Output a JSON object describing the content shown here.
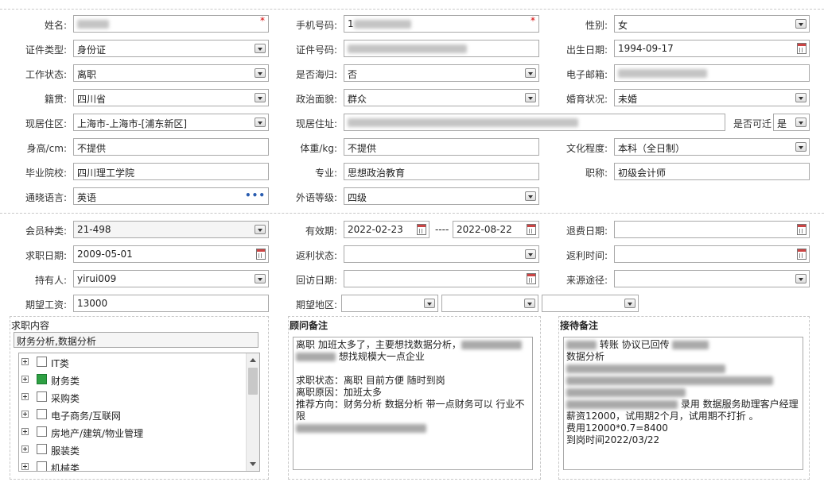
{
  "basic": {
    "name": {
      "label": "姓名:",
      "value": "",
      "required": "*"
    },
    "phone": {
      "label": "手机号码:",
      "value": "1",
      "required": "*"
    },
    "gender": {
      "label": "性别:",
      "value": "女"
    },
    "id_type": {
      "label": "证件类型:",
      "value": "身份证"
    },
    "id_number": {
      "label": "证件号码:",
      "value": ""
    },
    "birth_date": {
      "label": "出生日期:",
      "value": "1994-09-17"
    },
    "work_status": {
      "label": "工作状态:",
      "value": "离职"
    },
    "returnee": {
      "label": "是否海归:",
      "value": "否"
    },
    "email": {
      "label": "电子邮箱:",
      "value": ""
    },
    "native_place": {
      "label": "籍贯:",
      "value": "四川省"
    },
    "political": {
      "label": "政治面貌:",
      "value": "群众"
    },
    "marital": {
      "label": "婚育状况:",
      "value": "未婚"
    },
    "current_area": {
      "label": "现居住区:",
      "value": "上海市-上海市-[浦东新区]"
    },
    "current_address": {
      "label": "现居住址:",
      "value": ""
    },
    "relocate": {
      "label": "是否可迁",
      "value": "是"
    },
    "height": {
      "label": "身高/cm:",
      "value": "不提供"
    },
    "weight": {
      "label": "体重/kg:",
      "value": "不提供"
    },
    "education": {
      "label": "文化程度:",
      "value": "本科（全日制）"
    },
    "school": {
      "label": "毕业院校:",
      "value": "四川理工学院"
    },
    "major": {
      "label": "专业:",
      "value": "思想政治教育"
    },
    "title": {
      "label": "职称:",
      "value": "初级会计师"
    },
    "language": {
      "label": "通晓语言:",
      "value": "英语",
      "more": "•••"
    },
    "foreign_level": {
      "label": "外语等级:",
      "value": "四级"
    }
  },
  "member": {
    "member_type": {
      "label": "会员种类:",
      "value": "21-498"
    },
    "validity": {
      "label": "有效期:",
      "from": "2022-02-23",
      "sep": "----",
      "to": "2022-08-22"
    },
    "refund_date": {
      "label": "退费日期:",
      "value": ""
    },
    "job_date": {
      "label": "求职日期:",
      "value": "2009-05-01"
    },
    "rebate_status": {
      "label": "返利状态:",
      "value": ""
    },
    "rebate_time": {
      "label": "返利时间:",
      "value": ""
    },
    "holder": {
      "label": "持有人:",
      "value": "yirui009"
    },
    "visit_date": {
      "label": "回访日期:",
      "value": ""
    },
    "source": {
      "label": "来源途径:",
      "value": ""
    },
    "salary": {
      "label": "期望工资:",
      "value": "13000"
    },
    "expected_area": {
      "label": "期望地区:",
      "values": [
        "",
        "",
        ""
      ]
    }
  },
  "job_content": {
    "title": "求职内容",
    "selected": "财务分析,数据分析",
    "tree": [
      {
        "label": "IT类",
        "checked": false
      },
      {
        "label": "财务类",
        "checked": true
      },
      {
        "label": "采购类",
        "checked": false
      },
      {
        "label": "电子商务/互联网",
        "checked": false
      },
      {
        "label": "房地产/建筑/物业管理",
        "checked": false
      },
      {
        "label": "服装类",
        "checked": false
      },
      {
        "label": "机械类",
        "checked": false
      }
    ]
  },
  "consultant_note": {
    "title": "顾问备注",
    "lines": [
      "离职 加班太多了，主要想找数据分析，",
      "想找规模大一点企业",
      "",
      "求职状态：离职 目前方便 随时到岗",
      "离职原因：加班太多",
      "推荐方向：财务分析 数据分析 带一点财务可以 行业不限",
      ""
    ]
  },
  "reception_note": {
    "title": "接待备注",
    "lines": [
      "转账  协议已回传",
      "数据分析",
      "",
      "",
      "",
      "录用 数据服务助理客户经理",
      "薪资12000，试用期2个月，试用期不打折 。",
      "费用12000*0.7=8400",
      "到岗时间2022/03/22"
    ]
  }
}
